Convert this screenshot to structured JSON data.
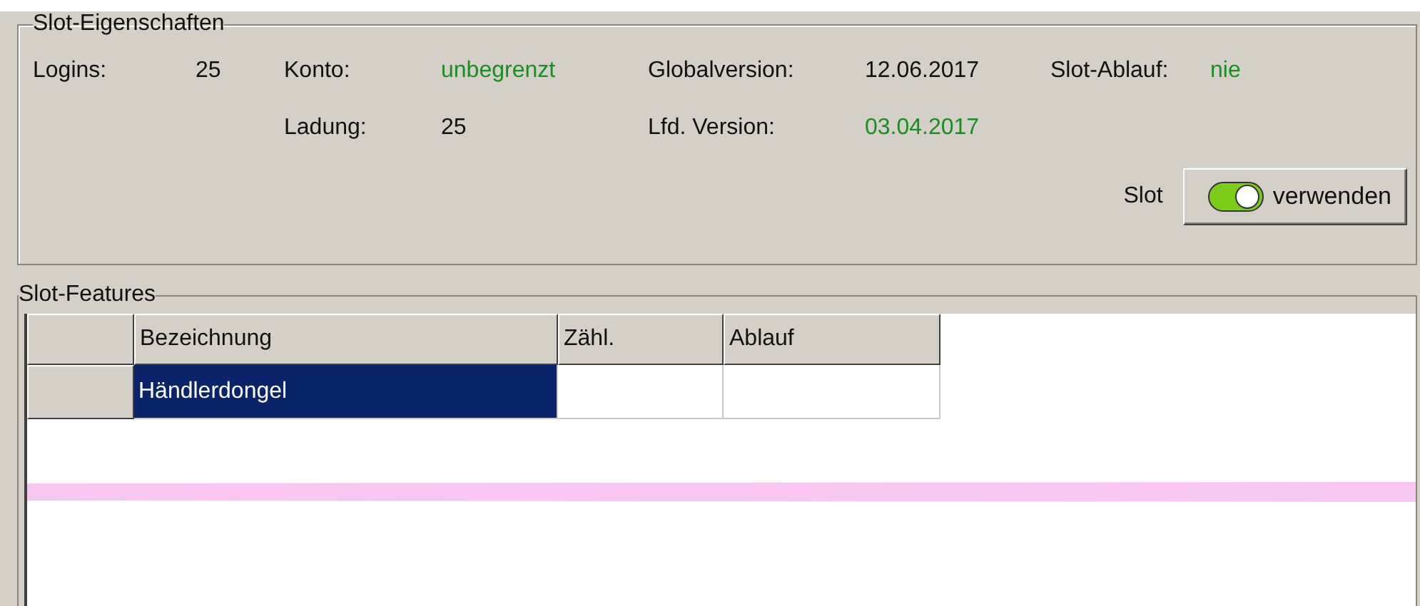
{
  "properties": {
    "title": "Slot-Eigenschaften",
    "rows": [
      [
        {
          "label": "Logins:",
          "value": "25",
          "highlight": false
        },
        {
          "label": "Konto:",
          "value": "unbegrenzt",
          "highlight": true
        },
        {
          "label": "Globalversion:",
          "value": "12.06.2017",
          "highlight": false
        },
        {
          "label": "Slot-Ablauf:",
          "value": "nie",
          "highlight": true
        }
      ],
      [
        null,
        {
          "label": "Ladung:",
          "value": "25",
          "highlight": false
        },
        {
          "label": "Lfd. Version:",
          "value": "03.04.2017",
          "highlight": true
        }
      ]
    ],
    "slot_label": "Slot",
    "slot_button": {
      "label": "verwenden",
      "on": true
    }
  },
  "features": {
    "title": "Slot-Features",
    "columns": [
      "Bezeichnung",
      "Zähl.",
      "Ablauf"
    ],
    "rows": [
      {
        "cells": [
          "Händlerdongel",
          "",
          ""
        ],
        "selected": true
      }
    ]
  }
}
